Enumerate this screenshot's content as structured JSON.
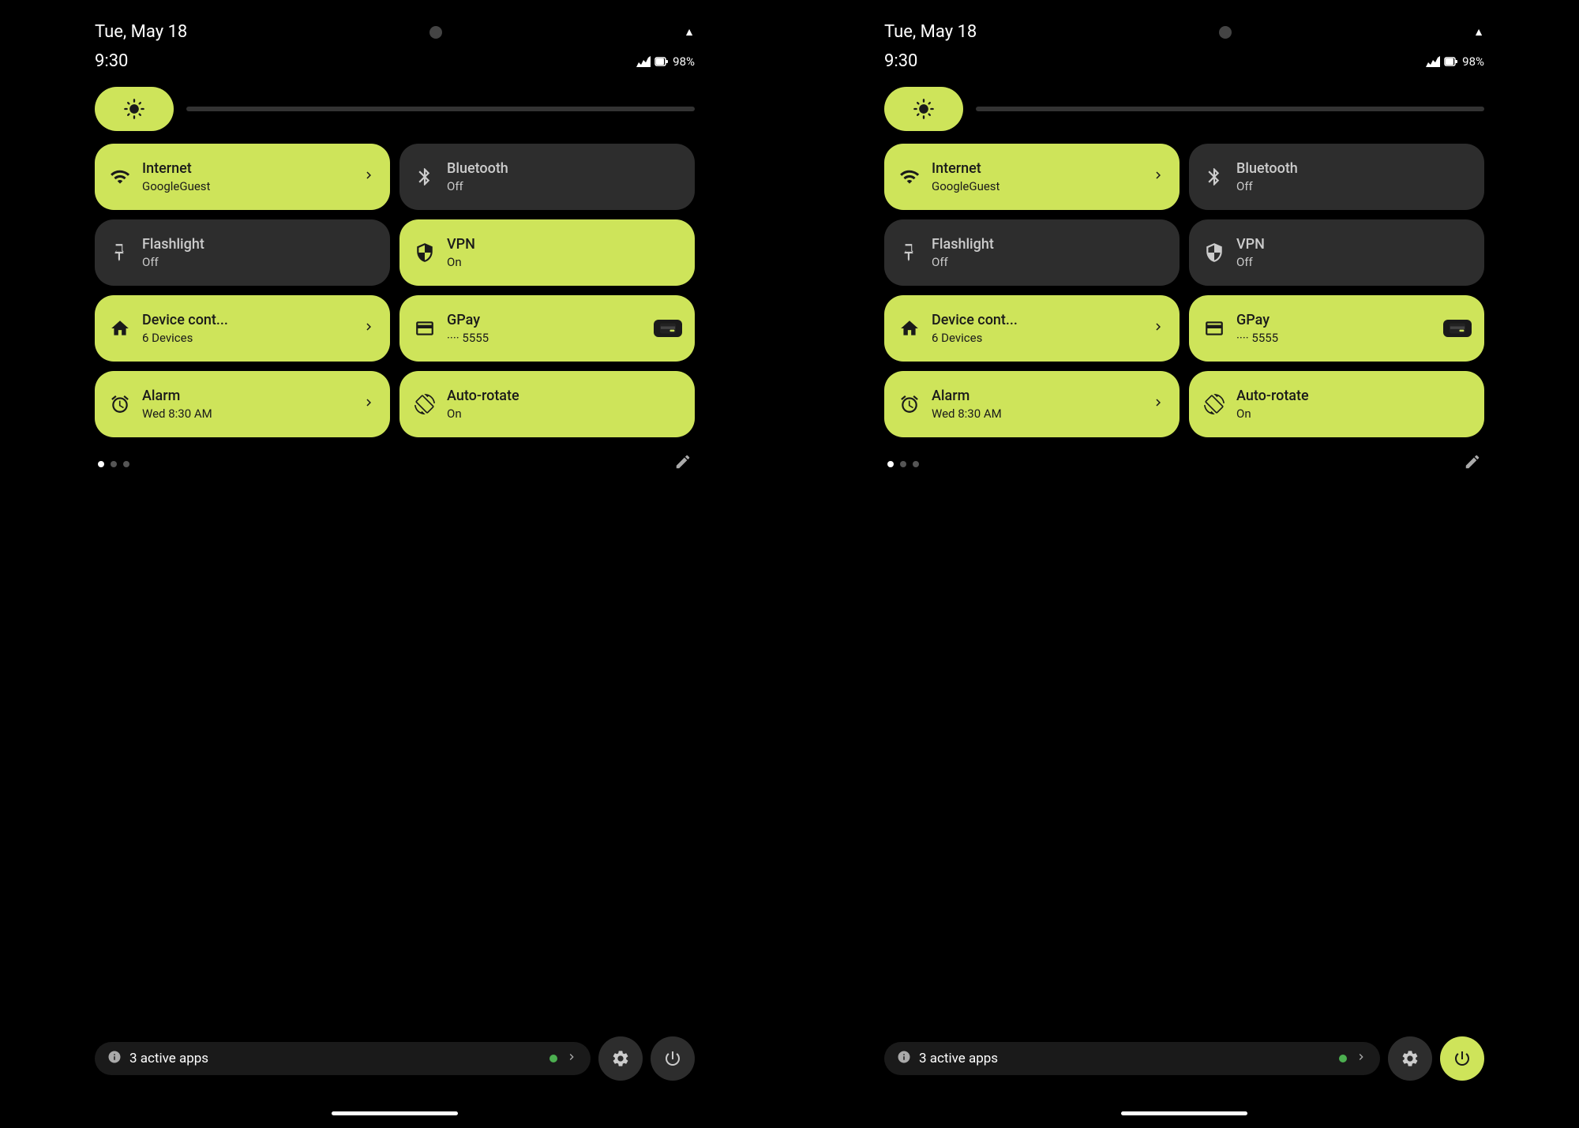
{
  "screens": [
    {
      "id": "screen-left",
      "statusBar": {
        "date": "Tue, May 18",
        "time": "9:30",
        "battery": "98%"
      },
      "brightness": {
        "label": "brightness-slider"
      },
      "tiles": [
        {
          "id": "internet",
          "title": "Internet",
          "subtitle": "GoogleGuest",
          "active": true,
          "hasChevron": true,
          "icon": "wifi"
        },
        {
          "id": "bluetooth",
          "title": "Bluetooth",
          "subtitle": "Off",
          "active": false,
          "hasChevron": false,
          "icon": "bluetooth"
        },
        {
          "id": "flashlight",
          "title": "Flashlight",
          "subtitle": "Off",
          "active": false,
          "hasChevron": false,
          "icon": "flashlight"
        },
        {
          "id": "vpn",
          "title": "VPN",
          "subtitle": "On",
          "active": true,
          "hasChevron": false,
          "icon": "vpn"
        },
        {
          "id": "device-control",
          "title": "Device cont...",
          "subtitle": "6 Devices",
          "active": true,
          "hasChevron": true,
          "icon": "home"
        },
        {
          "id": "gpay",
          "title": "GPay",
          "subtitle": "···· 5555",
          "active": true,
          "hasChevron": false,
          "icon": "card",
          "hasCardBadge": true
        },
        {
          "id": "alarm",
          "title": "Alarm",
          "subtitle": "Wed 8:30 AM",
          "active": true,
          "hasChevron": true,
          "icon": "alarm"
        },
        {
          "id": "autorotate",
          "title": "Auto-rotate",
          "subtitle": "On",
          "active": true,
          "hasChevron": false,
          "icon": "rotate"
        }
      ],
      "activeApps": {
        "count": "3",
        "label": "active apps"
      }
    },
    {
      "id": "screen-right",
      "statusBar": {
        "date": "Tue, May 18",
        "time": "9:30",
        "battery": "98%"
      },
      "brightness": {
        "label": "brightness-slider"
      },
      "tiles": [
        {
          "id": "internet",
          "title": "Internet",
          "subtitle": "GoogleGuest",
          "active": true,
          "hasChevron": true,
          "icon": "wifi"
        },
        {
          "id": "bluetooth",
          "title": "Bluetooth",
          "subtitle": "Off",
          "active": false,
          "hasChevron": false,
          "icon": "bluetooth"
        },
        {
          "id": "flashlight",
          "title": "Flashlight",
          "subtitle": "Off",
          "active": false,
          "hasChevron": false,
          "icon": "flashlight"
        },
        {
          "id": "vpn",
          "title": "VPN",
          "subtitle": "Off",
          "active": false,
          "hasChevron": false,
          "icon": "vpn"
        },
        {
          "id": "device-control",
          "title": "Device cont...",
          "subtitle": "6 Devices",
          "active": true,
          "hasChevron": true,
          "icon": "home"
        },
        {
          "id": "gpay",
          "title": "GPay",
          "subtitle": "···· 5555",
          "active": true,
          "hasChevron": false,
          "icon": "card",
          "hasCardBadge": true
        },
        {
          "id": "alarm",
          "title": "Alarm",
          "subtitle": "Wed 8:30 AM",
          "active": true,
          "hasChevron": true,
          "icon": "alarm"
        },
        {
          "id": "autorotate",
          "title": "Auto-rotate",
          "subtitle": "On",
          "active": true,
          "hasChevron": false,
          "icon": "rotate"
        }
      ],
      "activeApps": {
        "count": "3",
        "label": "active apps"
      }
    }
  ]
}
